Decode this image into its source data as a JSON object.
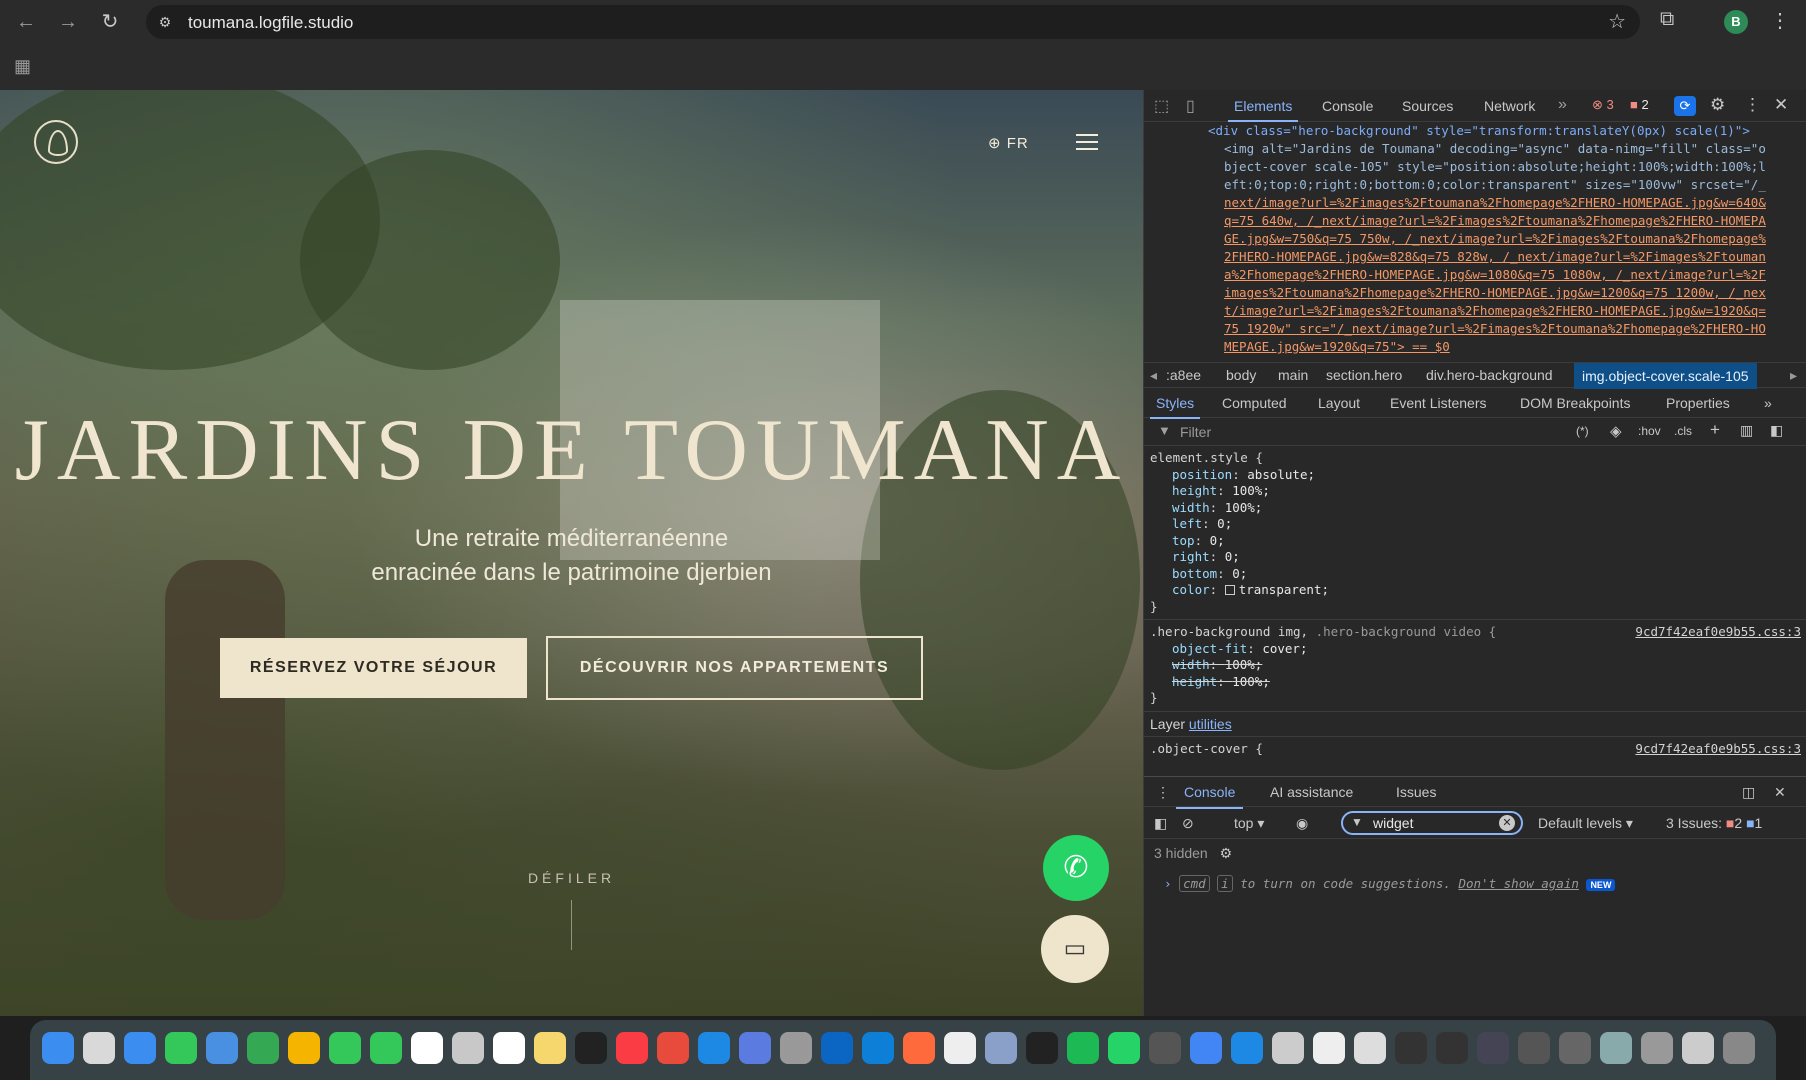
{
  "browser": {
    "url": "toumana.logfile.studio",
    "avatar_letter": "B"
  },
  "site": {
    "lang": "FR",
    "title": "JARDINS DE TOUMANA",
    "subtitle_line1": "Une retraite méditerranéenne",
    "subtitle_line2": "enracinée dans le patrimoine djerbien",
    "reserve_label": "RÉSERVEZ VOTRE SÉJOUR",
    "discover_label": "DÉCOUVRIR NOS APPARTEMENTS",
    "scroll_label": "DÉFILER"
  },
  "devtools": {
    "tabs": [
      "Elements",
      "Console",
      "Sources",
      "Network"
    ],
    "errors": "3",
    "warnings": "2",
    "dom_lines": [
      [
        "<div class=\"hero-background\" style=\"transform:translateY(0px) scale(1)\">"
      ],
      [
        "<img alt=\"Jardins de Toumana\" decoding=\"async\" data-nimg=\"fill\" class=\"o"
      ],
      [
        "bject-cover scale-105\" style=\"position:absolute;height:100%;width:100%;l"
      ],
      [
        "eft:0;top:0;right:0;bottom:0;color:transparent\" sizes=\"100vw\" srcset=\"/_"
      ],
      [
        "next/image?url=%2Fimages%2Ftoumana%2Fhomepage%2FHERO-HOMEPAGE.jpg&w=640&"
      ],
      [
        "q=75 640w, /_next/image?url=%2Fimages%2Ftoumana%2Fhomepage%2FHERO-HOMEPA"
      ],
      [
        "GE.jpg&w=750&q=75 750w, /_next/image?url=%2Fimages%2Ftoumana%2Fhomepage%"
      ],
      [
        "2FHERO-HOMEPAGE.jpg&w=828&q=75 828w, /_next/image?url=%2Fimages%2Ftouman"
      ],
      [
        "a%2Fhomepage%2FHERO-HOMEPAGE.jpg&w=1080&q=75 1080w, /_next/image?url=%2F"
      ],
      [
        "images%2Ftoumana%2Fhomepage%2FHERO-HOMEPAGE.jpg&w=1200&q=75 1200w, /_nex"
      ],
      [
        "t/image?url=%2Fimages%2Ftoumana%2Fhomepage%2FHERO-HOMEPAGE.jpg&w=1920&q="
      ],
      [
        "75 1920w\" src=\"/_next/image?url=%2Fimages%2Ftoumana%2Fhomepage%2FHERO-HO"
      ],
      [
        "MEPAGE.jpg&w=1920&q=75\"> == $0"
      ]
    ],
    "breadcrumbs": [
      ":a8ee",
      "body",
      "main",
      "section.hero",
      "div.hero-background",
      "img.object-cover.scale-105"
    ],
    "subtabs": [
      "Styles",
      "Computed",
      "Layout",
      "Event Listeners",
      "DOM Breakpoints",
      "Properties"
    ],
    "filter_placeholder": "Filter",
    "filter_tools": [
      ":hov",
      ".cls"
    ],
    "element_style": {
      "selector": "element.style {",
      "props": [
        [
          "position",
          "absolute;"
        ],
        [
          "height",
          "100%;"
        ],
        [
          "width",
          "100%;"
        ],
        [
          "left",
          "0;"
        ],
        [
          "top",
          "0;"
        ],
        [
          "right",
          "0;"
        ],
        [
          "bottom",
          "0;"
        ],
        [
          "color",
          "transparent;"
        ]
      ]
    },
    "hero_rule": {
      "selector": ".hero-background img,",
      "selector_dim": " .hero-background video {",
      "source": "9cd7f42eaf0e9b55.css:3",
      "props": [
        [
          "object-fit",
          "cover;",
          false
        ],
        [
          "width",
          "100%;",
          true
        ],
        [
          "height",
          "100%;",
          true
        ]
      ]
    },
    "layer_label": "Layer",
    "layer_link": "utilities",
    "object_cover_rule": {
      "selector": ".object-cover {",
      "source": "9cd7f42eaf0e9b55.css:3"
    },
    "drawer": {
      "tabs": [
        "Console",
        "AI assistance",
        "Issues"
      ],
      "context": "top",
      "filter_value": "widget",
      "levels": "Default levels",
      "issues_label": "3 Issues:",
      "issues_err": "2",
      "issues_info": "1",
      "hidden": "3 hidden",
      "prompt_kbd1": "cmd",
      "prompt_kbd2": "i",
      "prompt_text": "to turn on code suggestions.",
      "dont_show": "Don't show again",
      "new_badge": "NEW"
    }
  }
}
